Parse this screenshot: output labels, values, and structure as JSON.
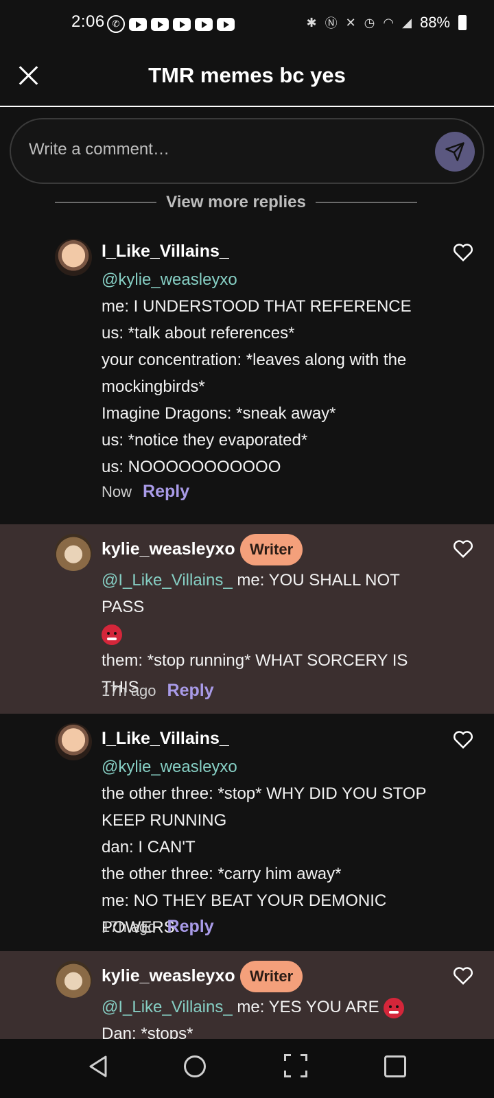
{
  "status_bar": {
    "time": "2:06",
    "battery": "88%"
  },
  "header": {
    "title": "TMR memes bc yes"
  },
  "comment_input": {
    "placeholder": "Write a comment…"
  },
  "view_more": {
    "label": "View more replies"
  },
  "comments": [
    {
      "username": "I_Like_Villains_",
      "mention": "@kylie_weasleyxo",
      "lines": [
        "me: I UNDERSTOOD THAT REFERENCE",
        "us: *talk about references*",
        "your concentration: *leaves along with the mockingbirds*",
        "Imagine Dragons: *sneak away*",
        "us: *notice they evaporated*",
        "us: NOOOOOOOOOOO"
      ],
      "time": "Now",
      "reply": "Reply"
    },
    {
      "username": "kylie_weasleyxo",
      "badge": "Writer",
      "mention": "@I_Like_Villains_",
      "first_line": " me: YOU SHALL NOT PASS",
      "lines": [
        "them: *stop running* WHAT SORCERY IS THIS"
      ],
      "time": "17h ago",
      "reply": "Reply"
    },
    {
      "username": "I_Like_Villains_",
      "mention": "@kylie_weasleyxo",
      "lines": [
        "the other three: *stop* WHY DID YOU STOP KEEP RUNNING",
        "dan: I CAN'T",
        "the other three: *carry him away*",
        "me: NO THEY BEAT YOUR DEMONIC POWERS"
      ],
      "time": "17h ago",
      "reply": "Reply"
    },
    {
      "username": "kylie_weasleyxo",
      "badge": "Writer",
      "mention": "@I_Like_Villains_",
      "first_line": " me: YES YOU ARE",
      "lines": [
        "Dan: *stops*"
      ]
    }
  ],
  "colors": {
    "accent": "#a99be8",
    "mention": "#86cfc4",
    "writer_badge": "#f4a07b",
    "writer_bg": "#3b2f2f",
    "send_button": "#5b5880"
  }
}
